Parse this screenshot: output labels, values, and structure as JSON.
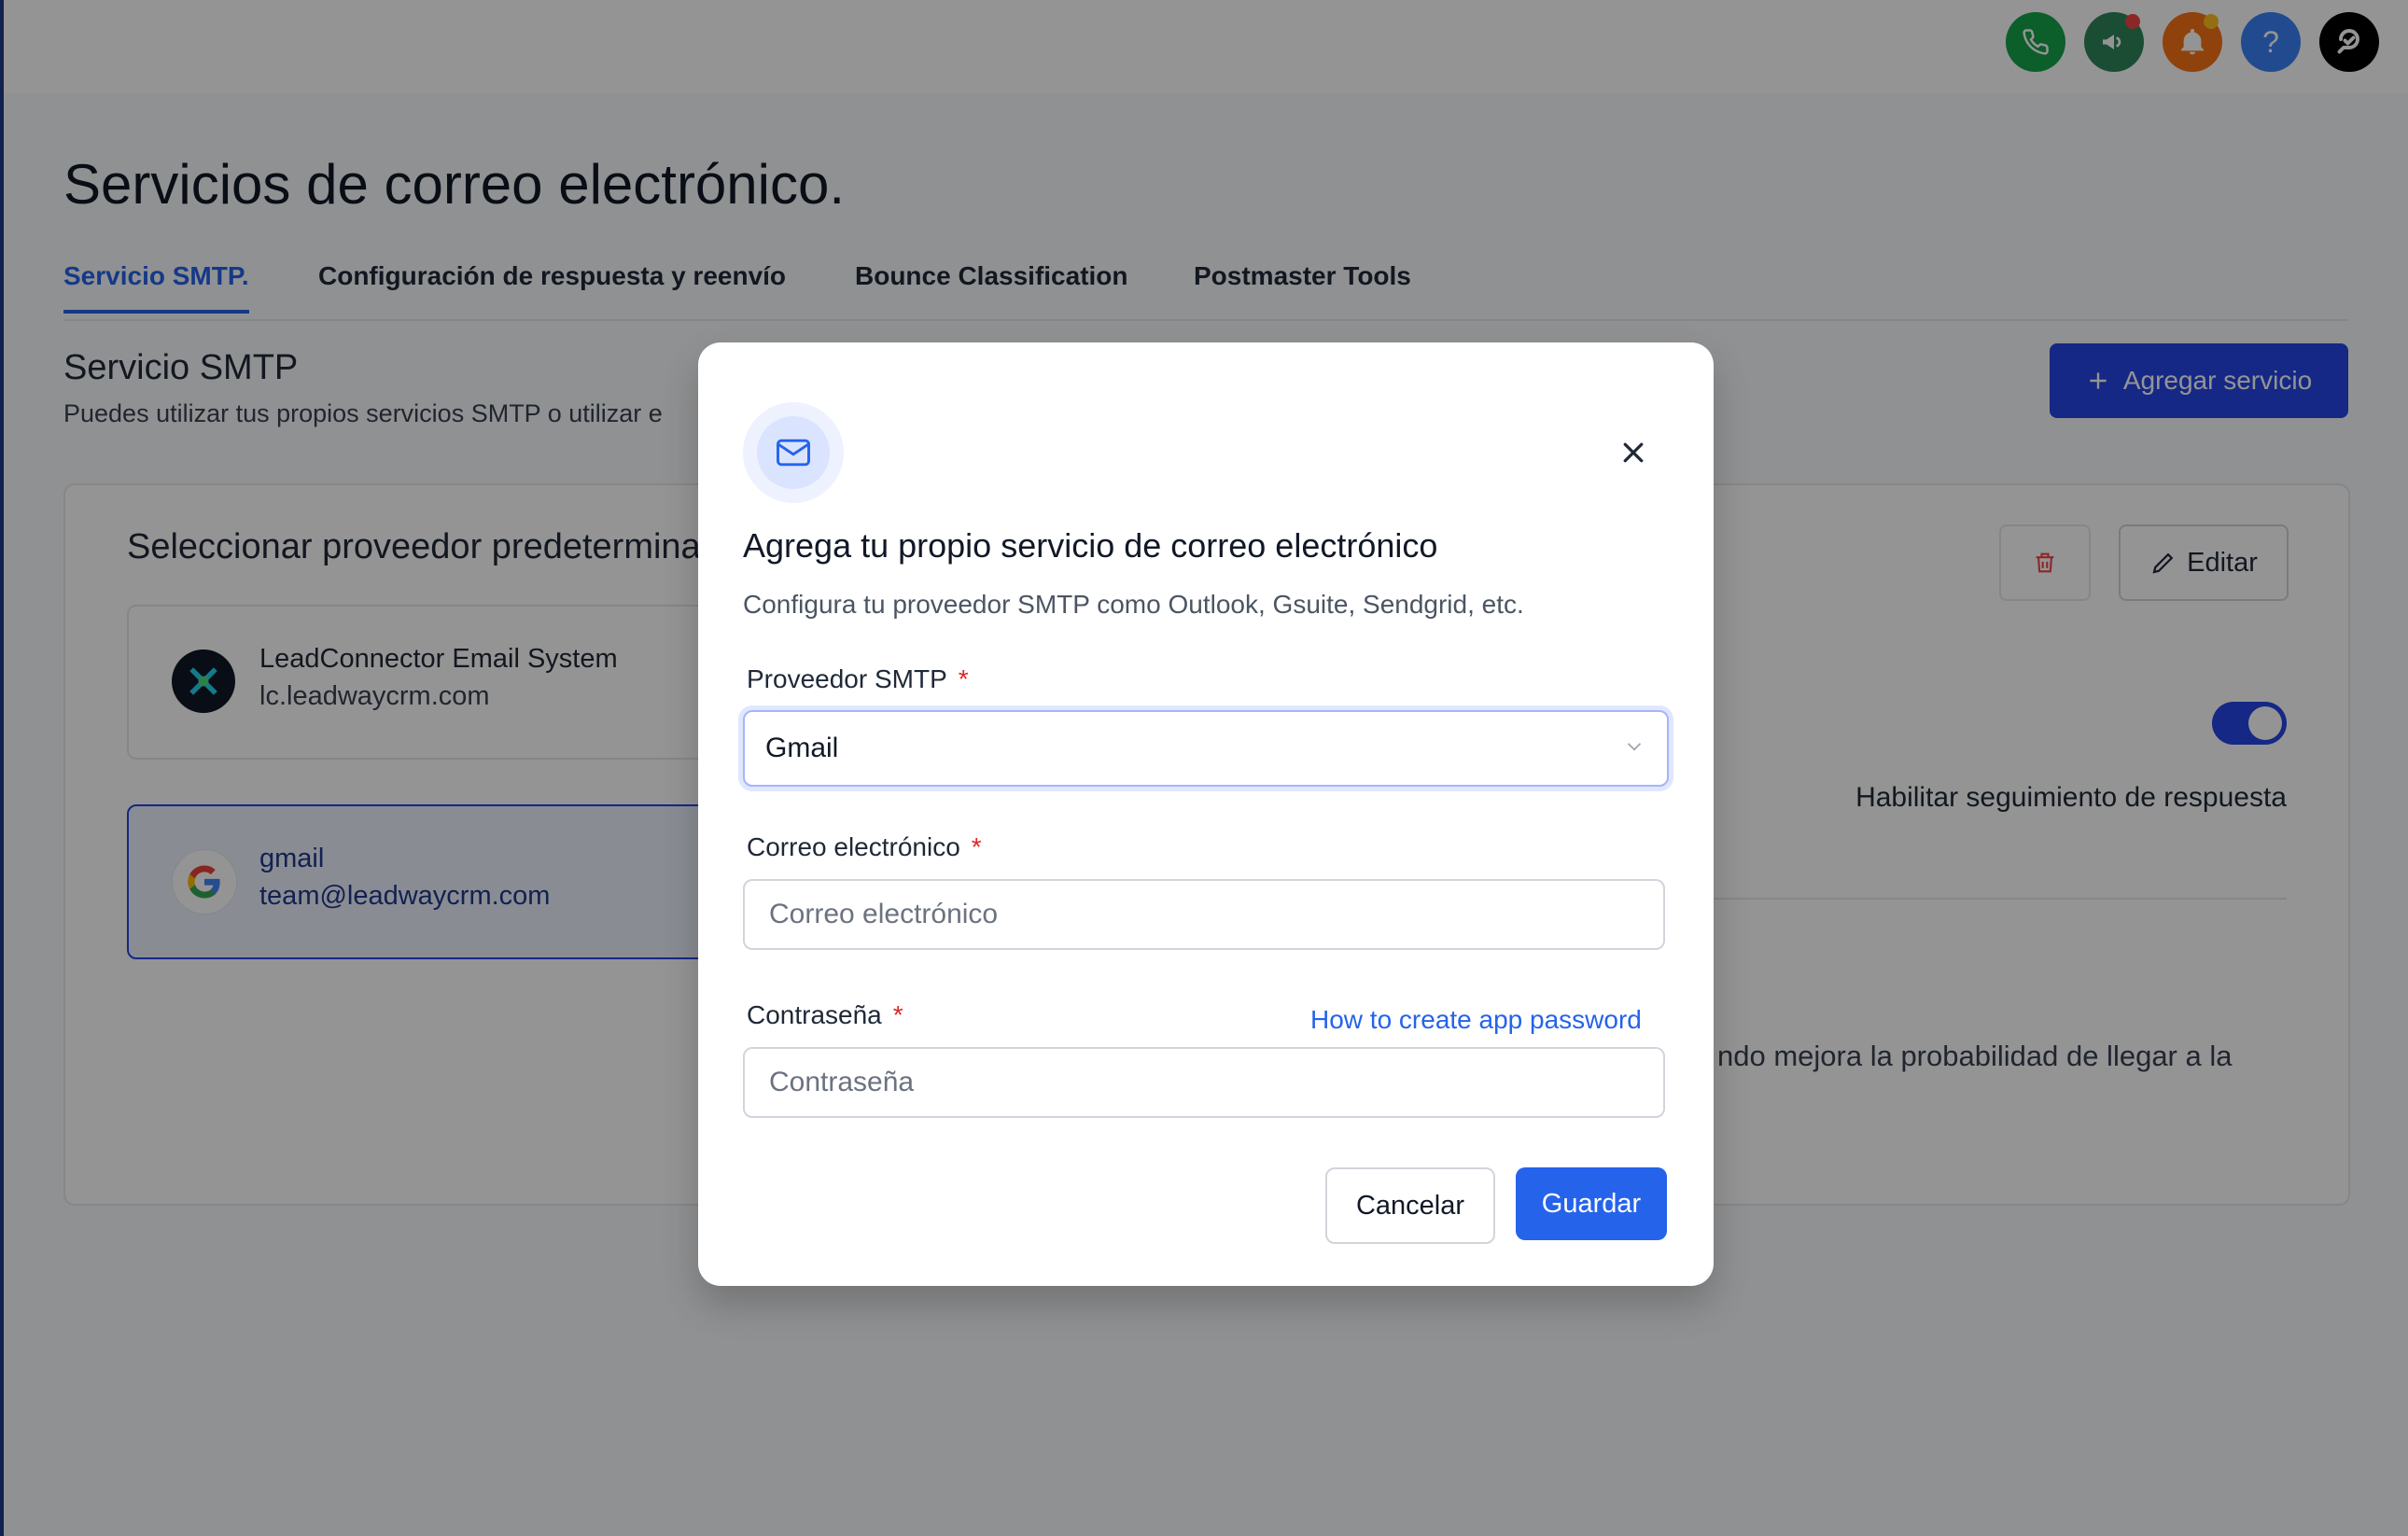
{
  "topbar": {
    "icons": [
      {
        "name": "phone-icon",
        "color": "#16a34a"
      },
      {
        "name": "megaphone-icon",
        "color": "#2f855a",
        "badge": "#ef4444"
      },
      {
        "name": "bell-icon",
        "color": "#f97316",
        "badge": "#fbbf24"
      },
      {
        "name": "help-icon",
        "color": "#3b82f6",
        "glyph": "?"
      },
      {
        "name": "chat-icon",
        "color": "#000000"
      }
    ]
  },
  "page": {
    "title": "Servicios de correo electrónico.",
    "tabs": [
      {
        "label": "Servicio SMTP.",
        "active": true
      },
      {
        "label": "Configuración de respuesta y reenvío"
      },
      {
        "label": "Bounce Classification"
      },
      {
        "label": "Postmaster Tools"
      }
    ],
    "section_title": "Servicio SMTP",
    "section_desc": "Puedes utilizar tus propios servicios SMTP o utilizar e",
    "add_button": "Agregar servicio",
    "card": {
      "title": "Seleccionar proveedor predetermina",
      "edit_button": "Editar",
      "providers": [
        {
          "name": "LeadConnector Email System",
          "sub": "lc.leadwaycrm.com"
        },
        {
          "name": "gmail",
          "sub": "team@leadwaycrm.com",
          "selected": true
        }
      ],
      "toggle_label": "Habilitar seguimiento de respuesta",
      "toggle_on": true,
      "reach_text": "ndo mejora la probabilidad de llegar a la"
    }
  },
  "modal": {
    "title": "Agrega tu propio servicio de correo electrónico",
    "description": "Configura tu proveedor SMTP como Outlook, Gsuite, Sendgrid, etc.",
    "provider_label": "Proveedor SMTP",
    "provider_value": "Gmail",
    "email_label": "Correo electrónico",
    "email_placeholder": "Correo electrónico",
    "password_label": "Contraseña",
    "password_placeholder": "Contraseña",
    "password_help_link": "How to create app password",
    "required_mark": "*",
    "cancel_button": "Cancelar",
    "save_button": "Guardar"
  },
  "colors": {
    "accent": "#2563eb",
    "required": "#dc2626",
    "overlay": "rgba(0,0,0,0.42)"
  }
}
